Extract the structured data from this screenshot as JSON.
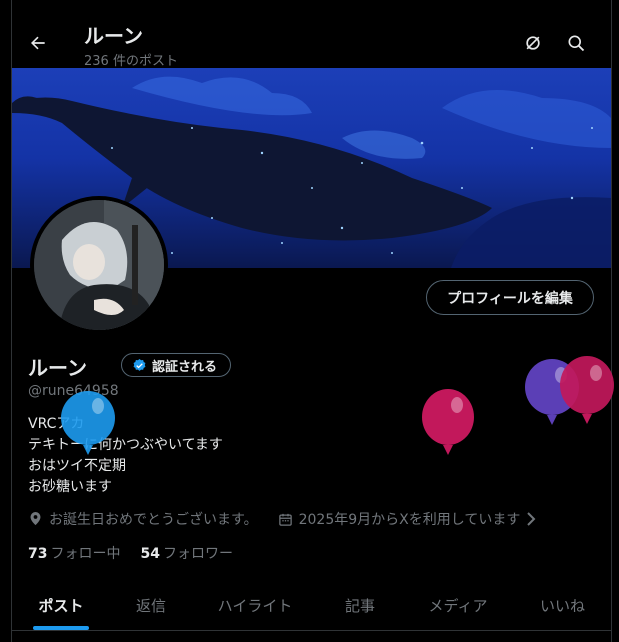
{
  "header": {
    "title": "ルーン",
    "post_count": "236 件のポスト"
  },
  "profile": {
    "name": "ルーン",
    "verify_label": "認証される",
    "handle": "@rune64958",
    "edit_label": "プロフィールを編集",
    "bio": [
      "VRCアカ",
      "テキトーに何かつぶやいてます",
      "おはツイ不定期",
      "お砂糖います"
    ],
    "birthday": "お誕生日おめでとうございます。",
    "joined": "2025年9月からXを利用しています",
    "following_count": "73",
    "following_label": "フォロー中",
    "followers_count": "54",
    "followers_label": "フォロワー"
  },
  "tabs": [
    "ポスト",
    "返信",
    "ハイライト",
    "記事",
    "メディア",
    "いいね"
  ],
  "icons": {
    "back": "back-arrow-icon",
    "grok": "grok-icon",
    "search": "search-icon",
    "location": "balloon-location-icon",
    "calendar": "calendar-icon",
    "chevron": "chevron-right-icon",
    "verified": "verified-badge-icon"
  },
  "colors": {
    "accent": "#1d9bf0",
    "balloon_blue": "#1d9bf0",
    "balloon_magenta": "#c2185b",
    "balloon_purple": "#5b3fb6"
  }
}
